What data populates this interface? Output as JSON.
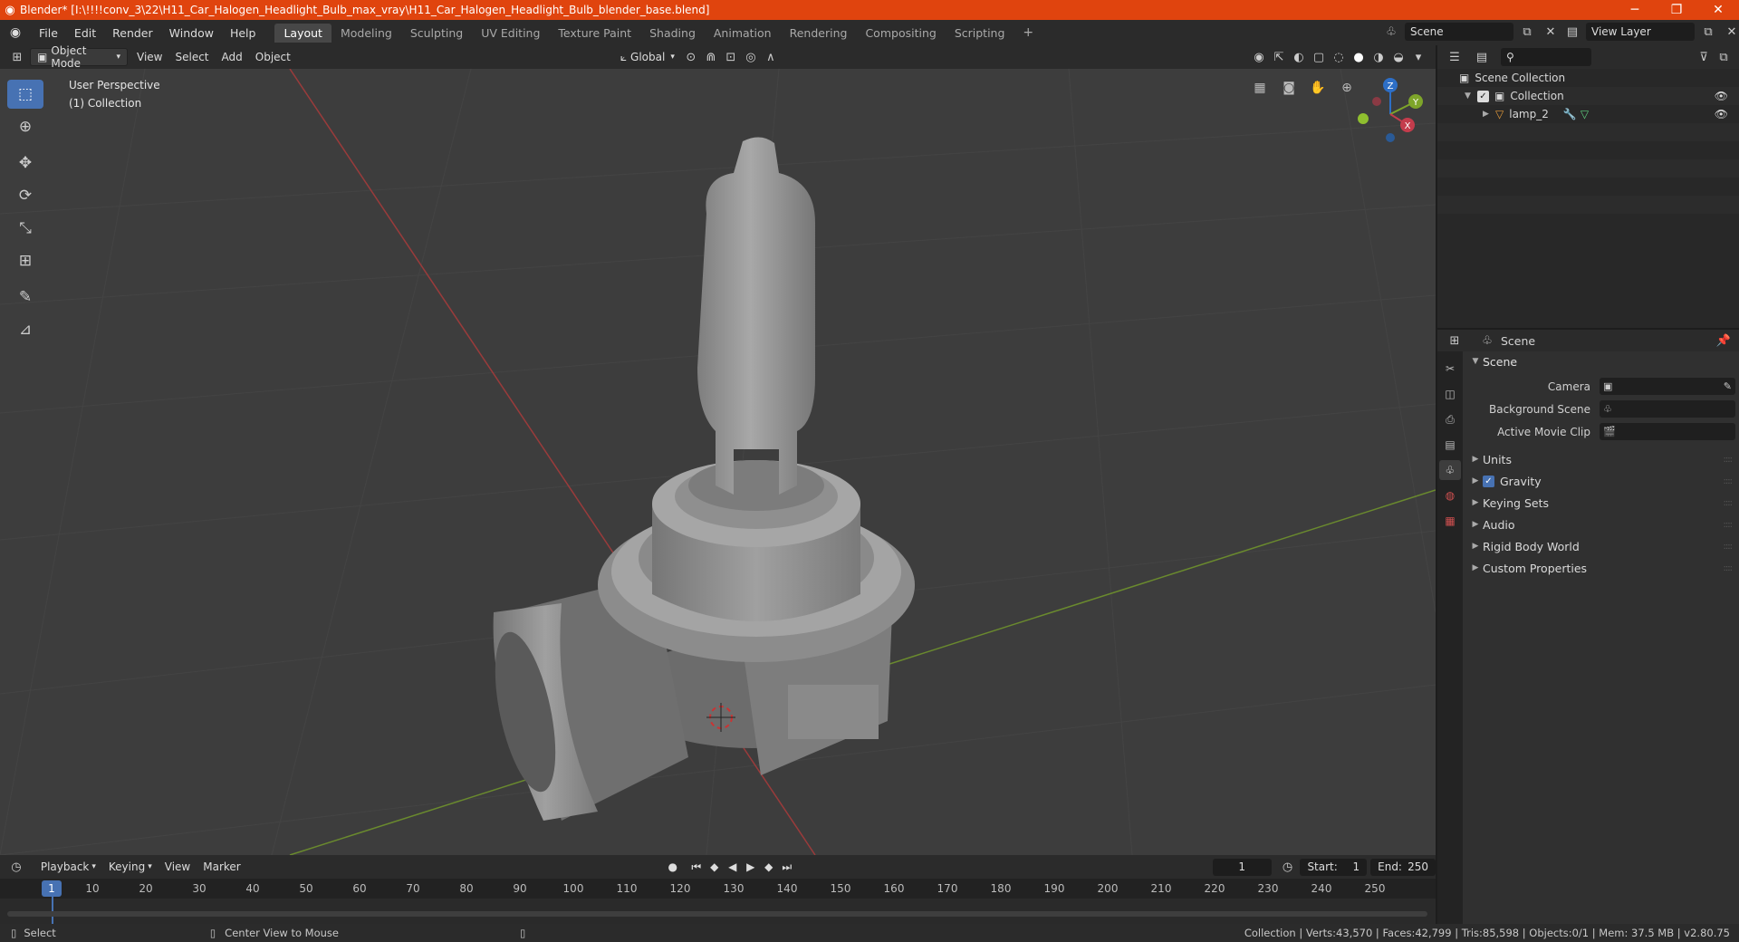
{
  "window": {
    "title": "Blender* [I:\\!!!!conv_3\\22\\H11_Car_Halogen_Headlight_Bulb_max_vray\\H11_Car_Halogen_Headlight_Bulb_blender_base.blend]",
    "minimize": "─",
    "maximize": "❐",
    "close": "✕"
  },
  "menu": [
    "File",
    "Edit",
    "Render",
    "Window",
    "Help"
  ],
  "workspaces": [
    "Layout",
    "Modeling",
    "Sculpting",
    "UV Editing",
    "Texture Paint",
    "Shading",
    "Animation",
    "Rendering",
    "Compositing",
    "Scripting"
  ],
  "active_workspace": "Layout",
  "scene_name": "Scene",
  "view_layer": "View Layer",
  "view3d": {
    "mode": "Object Mode",
    "menus": [
      "View",
      "Select",
      "Add",
      "Object"
    ],
    "orientation": "Global",
    "perspective_label": "User Perspective",
    "collection_label": "(1) Collection"
  },
  "gizmo": {
    "z": "Z",
    "y": "Y",
    "x": "X"
  },
  "outliner": {
    "root": "Scene Collection",
    "collection": "Collection",
    "object": "lamp_2"
  },
  "properties": {
    "header": "Scene",
    "panel": "Scene",
    "camera_label": "Camera",
    "background_label": "Background Scene",
    "movie_clip_label": "Active Movie Clip",
    "subpanels": [
      "Units",
      "Gravity",
      "Keying Sets",
      "Audio",
      "Rigid Body World",
      "Custom Properties"
    ]
  },
  "timeline": {
    "menus": [
      "Playback",
      "Keying",
      "View",
      "Marker"
    ],
    "current_frame": "1",
    "start_label": "Start:",
    "start": "1",
    "end_label": "End:",
    "end": "250",
    "ruler": [
      "1",
      "10",
      "20",
      "30",
      "40",
      "50",
      "60",
      "70",
      "80",
      "90",
      "100",
      "110",
      "120",
      "130",
      "140",
      "150",
      "160",
      "170",
      "180",
      "190",
      "200",
      "210",
      "220",
      "230",
      "240",
      "250"
    ]
  },
  "status": {
    "left_action": "Select",
    "middle_action": "Center View to Mouse",
    "stats": "Collection | Verts:43,570 | Faces:42,799 | Tris:85,598 | Objects:0/1 | Mem: 37.5 MB | v2.80.75"
  }
}
